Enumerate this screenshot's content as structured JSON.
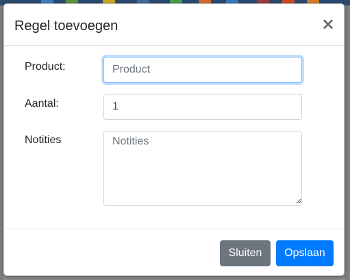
{
  "modal": {
    "title": "Regel toevoegen",
    "close_symbol": "×",
    "close_icon": "close-icon"
  },
  "form": {
    "product": {
      "label": "Product:",
      "value": "",
      "placeholder": "Product"
    },
    "aantal": {
      "label": "Aantal:",
      "value": "1",
      "placeholder": ""
    },
    "notities": {
      "label": "Notities",
      "value": "",
      "placeholder": "Notities"
    }
  },
  "footer": {
    "close_label": "Sluiten",
    "save_label": "Opslaan"
  },
  "colors": {
    "primary": "#007bff",
    "secondary": "#6c757d",
    "focus_border": "#80bdff"
  }
}
